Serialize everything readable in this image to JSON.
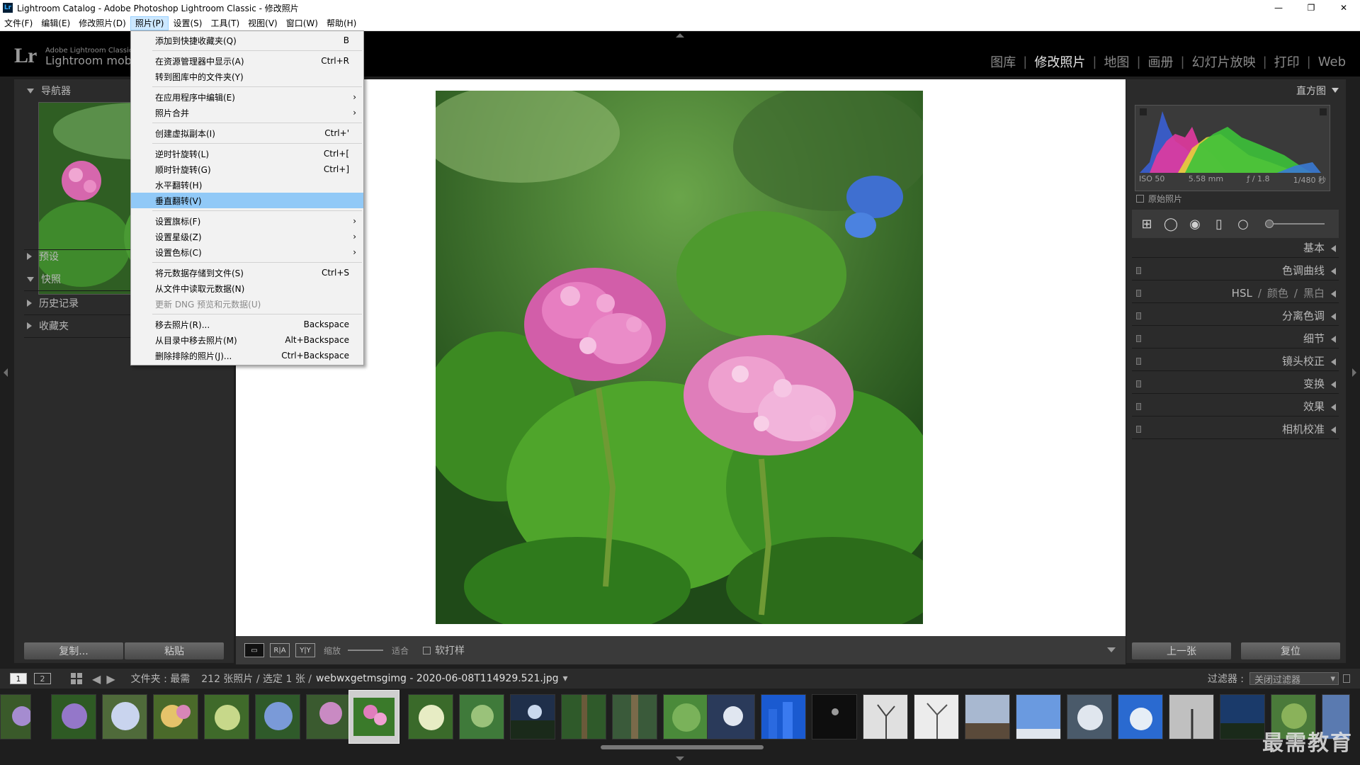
{
  "window": {
    "title": "Lightroom Catalog - Adobe Photoshop Lightroom Classic - 修改照片",
    "app_icon": "Lr",
    "controls": [
      "—",
      "❐",
      "✕"
    ]
  },
  "menubar": {
    "items": [
      "文件(F)",
      "编辑(E)",
      "修改照片(D)",
      "照片(P)",
      "设置(S)",
      "工具(T)",
      "视图(V)",
      "窗口(W)",
      "帮助(H)"
    ],
    "active_index": 3
  },
  "header": {
    "logo": "Lr",
    "brand_line1": "Adobe Lightroom Classic",
    "brand_line2": "Lightroom mobi",
    "modules": [
      "图库",
      "修改照片",
      "地图",
      "画册",
      "幻灯片放映",
      "打印",
      "Web"
    ],
    "active_module": "修改照片",
    "separator": "|"
  },
  "photo_menu": {
    "rows": [
      {
        "label": "添加到快捷收藏夹(Q)",
        "shortcut": "B"
      },
      {
        "sep": true
      },
      {
        "label": "在资源管理器中显示(A)",
        "shortcut": "Ctrl+R"
      },
      {
        "label": "转到图库中的文件夹(Y)",
        "shortcut": ""
      },
      {
        "sep": true
      },
      {
        "label": "在应用程序中编辑(E)",
        "shortcut": "",
        "submenu": true
      },
      {
        "label": "照片合并",
        "shortcut": "",
        "submenu": true
      },
      {
        "sep": true
      },
      {
        "label": "创建虚拟副本(I)",
        "shortcut": "Ctrl+'"
      },
      {
        "sep": true
      },
      {
        "label": "逆时针旋转(L)",
        "shortcut": "Ctrl+["
      },
      {
        "label": "顺时针旋转(G)",
        "shortcut": "Ctrl+]"
      },
      {
        "label": "水平翻转(H)",
        "shortcut": ""
      },
      {
        "label": "垂直翻转(V)",
        "shortcut": "",
        "highlighted": true
      },
      {
        "sep": true
      },
      {
        "label": "设置旗标(F)",
        "shortcut": "",
        "submenu": true
      },
      {
        "label": "设置星级(Z)",
        "shortcut": "",
        "submenu": true
      },
      {
        "label": "设置色标(C)",
        "shortcut": "",
        "submenu": true
      },
      {
        "sep": true
      },
      {
        "label": "将元数据存储到文件(S)",
        "shortcut": "Ctrl+S"
      },
      {
        "label": "从文件中读取元数据(N)",
        "shortcut": ""
      },
      {
        "label": "更新 DNG 预览和元数据(U)",
        "shortcut": "",
        "disabled": true
      },
      {
        "sep": true
      },
      {
        "label": "移去照片(R)...",
        "shortcut": "Backspace"
      },
      {
        "label": "从目录中移去照片(M)",
        "shortcut": "Alt+Backspace"
      },
      {
        "label": "删除排除的照片(J)...",
        "shortcut": "Ctrl+Backspace"
      }
    ],
    "submenu_glyph": "›"
  },
  "left_panel": {
    "navigator": "导航器",
    "presets": "预设",
    "snapshots": "快照",
    "history": "历史记录",
    "collections": "收藏夹",
    "plus": "+",
    "copy_button": "复制...",
    "paste_button": "粘贴"
  },
  "toolbar": {
    "view_loupe": "▭",
    "view_ba": "R|A",
    "view_yy": "Y|Y",
    "zoom_label": "缩放",
    "fit_label": "适合",
    "softproof_label": "软打样"
  },
  "right_panel": {
    "histogram_title": "直方图",
    "iso": "ISO 50",
    "focal": "5.58 mm",
    "aperture": "ƒ / 1.8",
    "shutter": "1/480 秒",
    "original_photo": "原始照片",
    "sections": [
      {
        "label": "基本",
        "toggle": false
      },
      {
        "label": "色调曲线",
        "toggle": true
      },
      {
        "label": "HSL",
        "extra": [
          "颜色",
          "黑白"
        ],
        "toggle": true
      },
      {
        "label": "分离色调",
        "toggle": true
      },
      {
        "label": "细节",
        "toggle": true
      },
      {
        "label": "镜头校正",
        "toggle": true
      },
      {
        "label": "变换",
        "toggle": true
      },
      {
        "label": "效果",
        "toggle": true
      },
      {
        "label": "相机校准",
        "toggle": true
      }
    ],
    "prev_button": "上一张",
    "reset_button": "复位"
  },
  "filmstrip_bar": {
    "page1": "1",
    "page2": "2",
    "source": "文件夹 : 最需",
    "count": "212 张照片 / 选定 1 张 /",
    "filename": "webwxgetmsgimg - 2020-06-08T114929.521.jpg",
    "filename_dd": "▾",
    "filter_label": "过滤器 :",
    "filter_value": "关闭过滤器",
    "prev_arrow": "◀",
    "next_arrow": "▶"
  },
  "watermark": "最需教育",
  "colors": {
    "accent_highlight": "#91c9f7",
    "panel_bg": "#2b2b2b",
    "header_bg": "#000000"
  }
}
